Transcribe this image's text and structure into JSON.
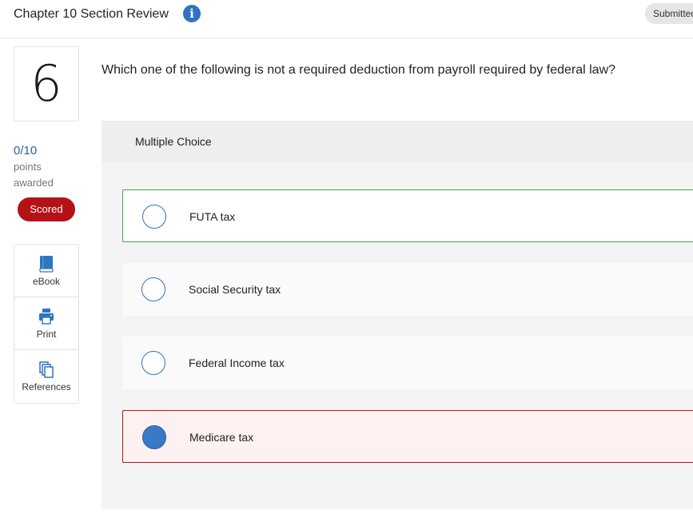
{
  "header": {
    "title": "Chapter 10 Section Review",
    "info_icon": "i",
    "status": "Submitted"
  },
  "question": {
    "number": "6",
    "score": "0/10",
    "score_label_line1": "points",
    "score_label_line2": "awarded",
    "badge": "Scored",
    "text": "Which one of the following is not a required deduction from payroll required by federal law?",
    "type_label": "Multiple Choice",
    "options": [
      {
        "label": "FUTA tax",
        "selected": false,
        "state": "correct"
      },
      {
        "label": "Social Security tax",
        "selected": false,
        "state": "neutral"
      },
      {
        "label": "Federal Income tax",
        "selected": false,
        "state": "neutral"
      },
      {
        "label": "Medicare tax",
        "selected": true,
        "state": "incorrect"
      }
    ]
  },
  "tools": [
    {
      "label": "eBook",
      "icon": "book-icon"
    },
    {
      "label": "Print",
      "icon": "printer-icon"
    },
    {
      "label": "References",
      "icon": "copy-icon"
    }
  ],
  "colors": {
    "accent": "#2d74c2",
    "scored_badge": "#b51218",
    "correct_border": "#4a9d4a",
    "incorrect_border": "#b51218"
  }
}
